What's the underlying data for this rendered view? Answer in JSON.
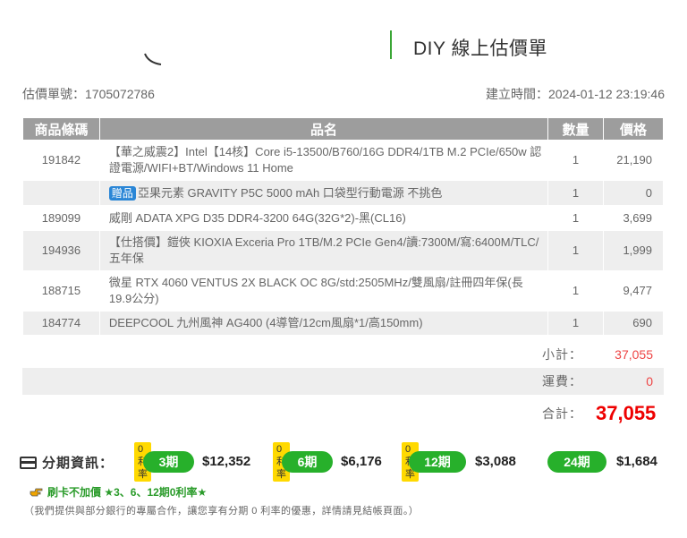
{
  "header": {
    "title": "DIY 線上估價單",
    "accent_color": "#3aa635"
  },
  "meta": {
    "quote_no": "估價單號：1705072786",
    "created_at": "建立時間：2024-01-12 23:19:46"
  },
  "table": {
    "columns": [
      "商品條碼",
      "品名",
      "數量",
      "價格"
    ],
    "rows": [
      {
        "code": "191842",
        "name": "【華之威震2】Intel【14核】Core i5-13500/B760/16G DDR4/1TB M.2 PCIe/650w 認證電源/WIFI+BT/Windows 11 Home",
        "qty": "1",
        "price": "21,190",
        "gift": ""
      },
      {
        "code": "",
        "name": "亞果元素 GRAVITY P5C 5000 mAh 口袋型行動電源 不挑色",
        "qty": "1",
        "price": "0",
        "gift": "贈品"
      },
      {
        "code": "189099",
        "name": "威剛 ADATA XPG D35 DDR4-3200 64G(32G*2)-黑(CL16)",
        "qty": "1",
        "price": "3,699",
        "gift": ""
      },
      {
        "code": "194936",
        "name": "【仕搭價】鎧俠 KIOXIA Exceria Pro 1TB/M.2 PCIe Gen4/讀:7300M/寫:6400M/TLC/五年保",
        "qty": "1",
        "price": "1,999",
        "gift": ""
      },
      {
        "code": "188715",
        "name": "微星 RTX 4060 VENTUS 2X BLACK OC 8G/std:2505MHz/雙風扇/註冊四年保(長19.9公分)",
        "qty": "1",
        "price": "9,477",
        "gift": ""
      },
      {
        "code": "184774",
        "name": "DEEPCOOL 九州風神 AG400 (4導管/12cm風扇*1/高150mm)",
        "qty": "1",
        "price": "690",
        "gift": ""
      }
    ]
  },
  "summary": {
    "subtotal_label": "小計：",
    "subtotal": "37,055",
    "shipping_label": "運費：",
    "shipping": "0",
    "total_label": "合計：",
    "total": "37,055"
  },
  "installments": {
    "label": "分期資訊：",
    "zero_tag": "0利率",
    "plans": [
      {
        "period": "3期",
        "amount": "$12,352",
        "zero": true
      },
      {
        "period": "6期",
        "amount": "$6,176",
        "zero": true
      },
      {
        "period": "12期",
        "amount": "$3,088",
        "zero": true
      },
      {
        "period": "24期",
        "amount": "$1,684",
        "zero": false
      }
    ]
  },
  "promo": {
    "text": "刷卡不加價 ★3、6、12期0利率★",
    "note": "（我們提供與部分銀行的專屬合作，讓您享有分期 0 利率的優惠，詳情請見結帳頁面。）"
  }
}
